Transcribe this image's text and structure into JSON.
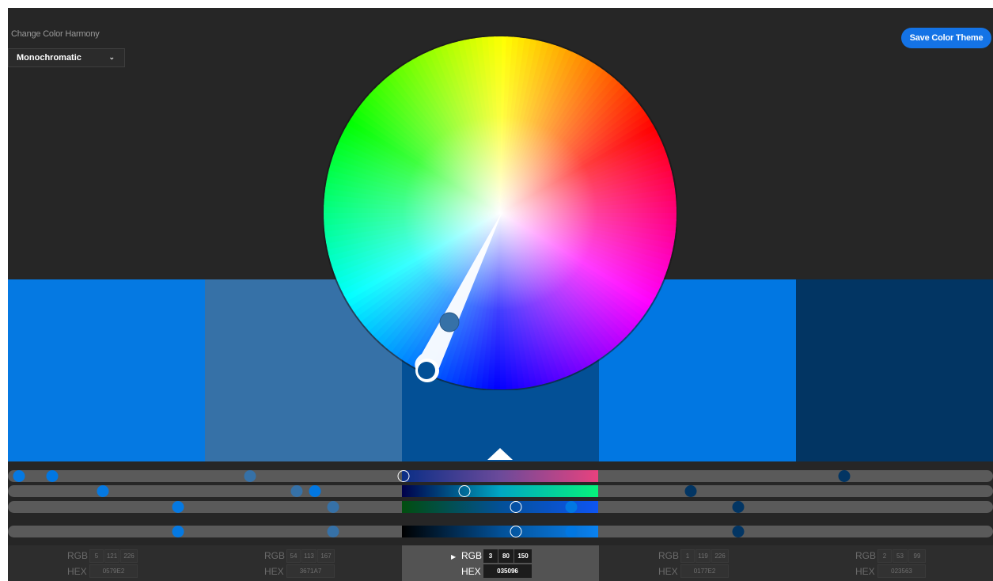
{
  "header": {
    "harmony_label": "Change Color Harmony",
    "harmony_value": "Monochromatic",
    "save_label": "Save Color Theme"
  },
  "swatches": [
    {
      "color": "#0579E2",
      "rgb": [
        "5",
        "121",
        "226"
      ],
      "hex": "0579E2",
      "active": false
    },
    {
      "color": "#3671A7",
      "rgb": [
        "54",
        "113",
        "167"
      ],
      "hex": "3671A7",
      "active": false
    },
    {
      "color": "#035096",
      "rgb": [
        "3",
        "80",
        "150"
      ],
      "hex": "035096",
      "active": true
    },
    {
      "color": "#0177E2",
      "rgb": [
        "1",
        "119",
        "226"
      ],
      "hex": "0177E2",
      "active": false
    },
    {
      "color": "#023563",
      "rgb": [
        "2",
        "53",
        "99"
      ],
      "hex": "023563",
      "active": false
    }
  ],
  "labels": {
    "rgb": "RGB",
    "hex": "HEX"
  },
  "slider_knobs": [
    [
      0.011,
      0.246,
      0.045,
      0.849
    ],
    [
      0.096,
      0.293,
      0.312,
      0.693
    ],
    [
      0.173,
      0.33,
      0.572,
      0.741
    ],
    [
      0.173,
      0.33,
      0.572,
      0.741
    ]
  ]
}
